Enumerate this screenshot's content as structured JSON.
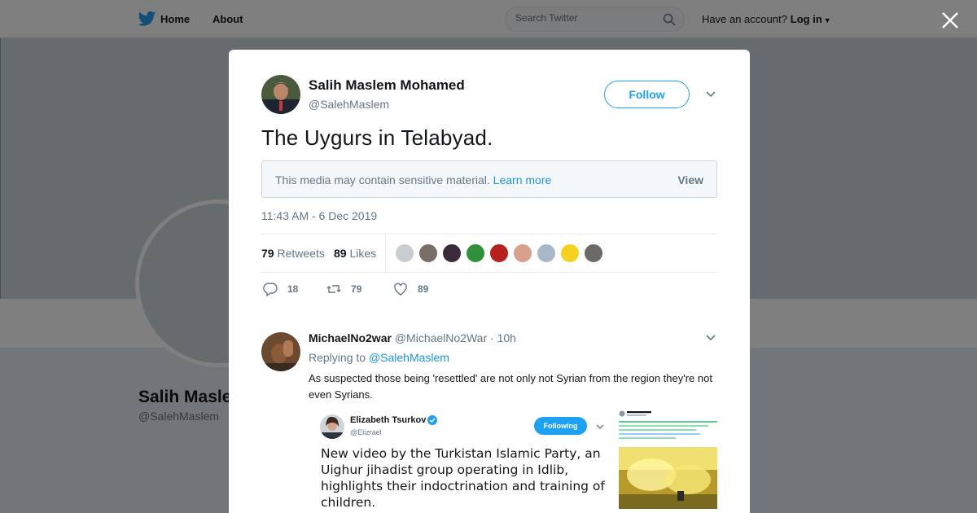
{
  "topbar": {
    "home_label": "Home",
    "about_label": "About",
    "search_placeholder": "Search Twitter",
    "account_prompt": "Have an account?",
    "login_label": "Log in"
  },
  "profile": {
    "name": "Salih Maslem",
    "handle": "@SalehMaslem"
  },
  "tweet": {
    "author_name": "Salih Maslem Mohamed",
    "author_handle": "@SalehMaslem",
    "follow_label": "Follow",
    "text": "The Uygurs in Telabyad.",
    "sensitive_message": "This media may contain sensitive material.",
    "learn_more_label": "Learn more",
    "view_label": "View",
    "timestamp": "11:43 AM - 6 Dec 2019",
    "retweets_count": "79",
    "retweets_label": "Retweets",
    "likes_count": "89",
    "likes_label": "Likes",
    "reply_count": "18",
    "retweet_action_count": "79",
    "like_action_count": "89",
    "liker_avatar_colors": [
      "#c9cdd1",
      "#7a6f68",
      "#3b2a3a",
      "#2f8f3a",
      "#b8201e",
      "#d9a08a",
      "#a7b8c8",
      "#f6d21f",
      "#6b6a66"
    ]
  },
  "reply": {
    "name": "MichaelNo2war",
    "handle": "@MichaelNo2War",
    "age": "10h",
    "replying_prefix": "Replying to",
    "replying_mention": "@SalehMaslem",
    "text": "As suspected those being 'resettled' are not only not Syrian from the region they're not even Syrians."
  },
  "embed": {
    "name": "Elizabeth Tsurkov",
    "handle": "@Elizrael",
    "following_label": "Following",
    "text": "New video by the Turkistan Islamic Party, an Uighur jihadist group operating in Idlib, highlights their indoctrination and training of children."
  },
  "colors": {
    "brand": "#1da1f2",
    "link": "#1b95e0",
    "muted": "#657786",
    "text": "#14171a"
  }
}
